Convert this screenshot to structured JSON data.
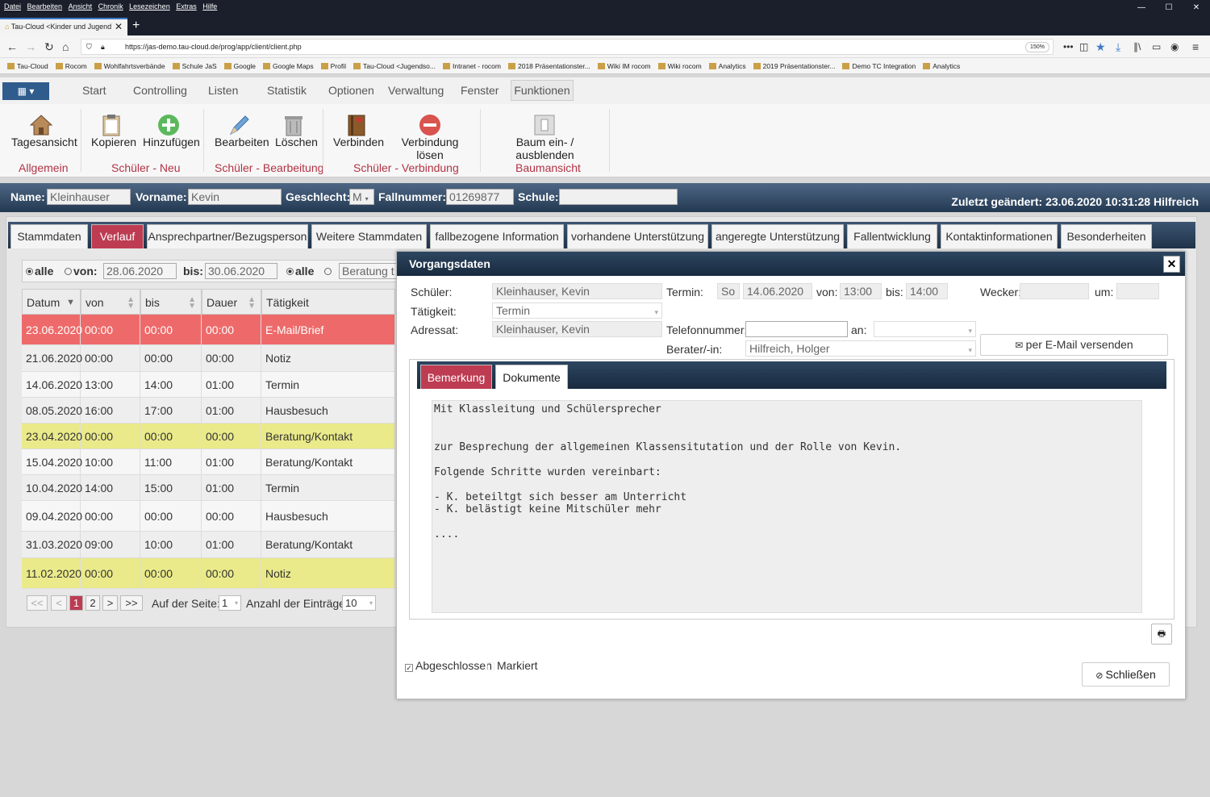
{
  "browser": {
    "menu": [
      "Datei",
      "Bearbeiten",
      "Ansicht",
      "Chronik",
      "Lesezeichen",
      "Extras",
      "Hilfe"
    ],
    "tab_title": "Tau-Cloud <Kinder und Jugend",
    "url": "https://jas-demo.tau-cloud.de/prog/app/client/client.php",
    "zoom": "150%",
    "bookmarks": [
      "Tau-Cloud",
      "Rocom",
      "Wohlfahrtsverbände",
      "Schule JaS",
      "Google",
      "Google Maps",
      "Profil",
      "Tau-Cloud <Jugendso...",
      "Intranet - rocom",
      "2018 Präsentationster...",
      "Wiki IM rocom",
      "Wiki rocom",
      "Analytics",
      "2019 Präsentationster...",
      "Demo TC Integration",
      "Analytics"
    ]
  },
  "app_menu": [
    "Start",
    "Controlling",
    "Listen",
    "Statistik",
    "Optionen",
    "Verwaltung",
    "Fenster",
    "Funktionen"
  ],
  "ribbon": {
    "buttons": [
      "Tagesansicht",
      "Kopieren",
      "Hinzufügen",
      "Bearbeiten",
      "Löschen",
      "Verbinden",
      "Verbindung lösen",
      "Baum ein- / ausblenden"
    ],
    "groups": [
      "Allgemein",
      "Schüler - Neu",
      "Schüler - Bearbeitung",
      "Schüler - Verbindung",
      "Baumansicht"
    ]
  },
  "infobar": {
    "name_label": "Name:",
    "name": "Kleinhauser",
    "vorname_label": "Vorname:",
    "vorname": "Kevin",
    "geschlecht_label": "Geschlecht:",
    "geschlecht": "M",
    "fallnummer_label": "Fallnummer:",
    "fallnummer": "01269877",
    "schule_label": "Schule:",
    "schule": "",
    "last_changed": "Zuletzt geändert: 23.06.2020 10:31:28 Hilfreich"
  },
  "main_tabs": [
    "Stammdaten",
    "Verlauf",
    "Ansprechpartner/Bezugsperson",
    "Weitere Stammdaten",
    "fallbezogene Information",
    "vorhandene Unterstützung",
    "angeregte Unterstützung",
    "Fallentwicklung",
    "Kontaktinformationen",
    "Besonderheiten"
  ],
  "filter": {
    "alle": "alle",
    "von_label": "von:",
    "von": "28.06.2020",
    "bis_label": "bis:",
    "bis": "30.06.2020",
    "alle2": "alle",
    "type": "Beratung t"
  },
  "table": {
    "headers": [
      "Datum",
      "von",
      "bis",
      "Dauer",
      "Tätigkeit"
    ],
    "rows": [
      [
        "23.06.2020",
        "00:00",
        "00:00",
        "00:00",
        "E-Mail/Brief"
      ],
      [
        "21.06.2020",
        "00:00",
        "00:00",
        "00:00",
        "Notiz"
      ],
      [
        "14.06.2020",
        "13:00",
        "14:00",
        "01:00",
        "Termin"
      ],
      [
        "08.05.2020",
        "16:00",
        "17:00",
        "01:00",
        "Hausbesuch"
      ],
      [
        "23.04.2020",
        "00:00",
        "00:00",
        "00:00",
        "Beratung/Kontakt"
      ],
      [
        "15.04.2020",
        "10:00",
        "11:00",
        "01:00",
        "Beratung/Kontakt"
      ],
      [
        "10.04.2020",
        "14:00",
        "15:00",
        "01:00",
        "Termin"
      ],
      [
        "09.04.2020",
        "00:00",
        "00:00",
        "00:00",
        "Hausbesuch"
      ],
      [
        "31.03.2020",
        "09:00",
        "10:00",
        "01:00",
        "Beratung/Kontakt"
      ],
      [
        "11.02.2020",
        "00:00",
        "00:00",
        "00:00",
        "Notiz"
      ]
    ],
    "row_colors": [
      "#ee6a6a",
      "#eeeeee",
      "#f6f6f6",
      "#eeeeee",
      "#eaea8a",
      "#f6f6f6",
      "#eeeeee",
      "#f6f6f6",
      "#eeeeee",
      "#eaea8a"
    ]
  },
  "pager": {
    "first": "<<",
    "prev": "<",
    "pages": [
      "1",
      "2"
    ],
    "next": ">",
    "last": ">>",
    "page_label": "Auf der Seite:",
    "page_value": "1",
    "count_label": "Anzahl der Einträge:",
    "count_value": "10"
  },
  "modal": {
    "title": "Vorgangsdaten",
    "schueler_label": "Schüler:",
    "schueler": "Kleinhauser, Kevin",
    "taetigkeit_label": "Tätigkeit:",
    "taetigkeit": "Termin",
    "adressat_label": "Adressat:",
    "adressat": "Kleinhauser, Kevin",
    "termin_label": "Termin:",
    "termin_day": "So",
    "termin_date": "14.06.2020",
    "von_label": "von:",
    "von": "13:00",
    "bis_label": "bis:",
    "bis": "14:00",
    "wecker_label": "Wecker:",
    "wecker": "",
    "um_label": "um:",
    "um": "",
    "telefon_label": "Telefonnummer:",
    "telefon": "",
    "an_label": "an:",
    "an": "",
    "berater_label": "Berater/-in:",
    "berater": "Hilfreich, Holger",
    "mail_button": "per E-Mail versenden",
    "tabs": [
      "Bemerkung",
      "Dokumente"
    ],
    "remark_lines": [
      "Mit Klassleitung und Schülersprecher",
      "",
      "",
      "zur Besprechung der allgemeinen Klassensitutation und der Rolle von Kevin.",
      "",
      "Folgende Schritte wurden vereinbart:",
      "",
      "- K. beteiltgt sich besser am Unterricht",
      "- K. belästigt keine Mitschüler mehr",
      "",
      "...."
    ],
    "abgeschlossen": "Abgeschlossen",
    "markiert": "Markiert",
    "close_button": "Schließen"
  }
}
